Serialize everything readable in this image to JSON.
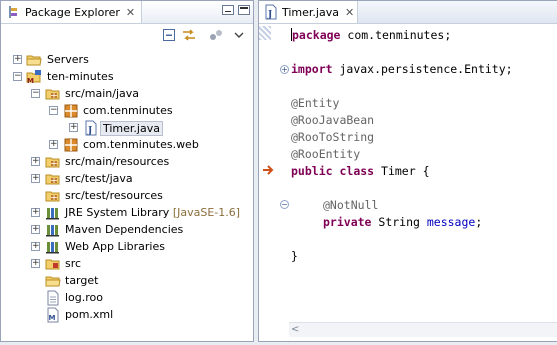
{
  "explorer": {
    "tab_title": "Package Explorer",
    "items": [
      {
        "label": "Servers",
        "icon": "folder-icon"
      },
      {
        "label": "ten-minutes",
        "icon": "maven-project-icon"
      },
      {
        "label": "src/main/java",
        "icon": "source-folder-icon"
      },
      {
        "label": "com.tenminutes",
        "icon": "package-icon"
      },
      {
        "label": "Timer.java",
        "icon": "java-file-icon"
      },
      {
        "label": "com.tenminutes.web",
        "icon": "package-icon"
      },
      {
        "label": "src/main/resources",
        "icon": "source-folder-icon"
      },
      {
        "label": "src/test/java",
        "icon": "source-folder-icon"
      },
      {
        "label": "src/test/resources",
        "icon": "source-folder-icon"
      },
      {
        "label": "JRE System Library",
        "decoration": "[JavaSE-1.6]",
        "icon": "library-icon"
      },
      {
        "label": "Maven Dependencies",
        "icon": "library-icon"
      },
      {
        "label": "Web App Libraries",
        "icon": "library-icon"
      },
      {
        "label": "src",
        "icon": "folder-icon"
      },
      {
        "label": "target",
        "icon": "folder-icon"
      },
      {
        "label": "log.roo",
        "icon": "text-file-icon"
      },
      {
        "label": "pom.xml",
        "icon": "xml-file-icon"
      }
    ]
  },
  "editor": {
    "tab_title": "Timer.java",
    "lines": {
      "pkg_kw": "package",
      "pkg_rest": " com.tenminutes;",
      "import_kw": "import",
      "import_rest": " javax.persistence.Entity;",
      "ann1": "@Entity",
      "ann2": "@RooJavaBean",
      "ann3": "@RooToString",
      "ann4": "@RooEntity",
      "class_kw1": "public",
      "class_kw2": "class",
      "class_rest": " Timer {",
      "ann5": "@NotNull",
      "field_kw": "private",
      "field_type": " String ",
      "field_name": "message",
      "field_end": ";",
      "close": "}"
    }
  },
  "colors": {
    "keyword": "#7f0055",
    "annotation": "#646464",
    "field": "#0000c0",
    "border": "#99a4b8"
  }
}
